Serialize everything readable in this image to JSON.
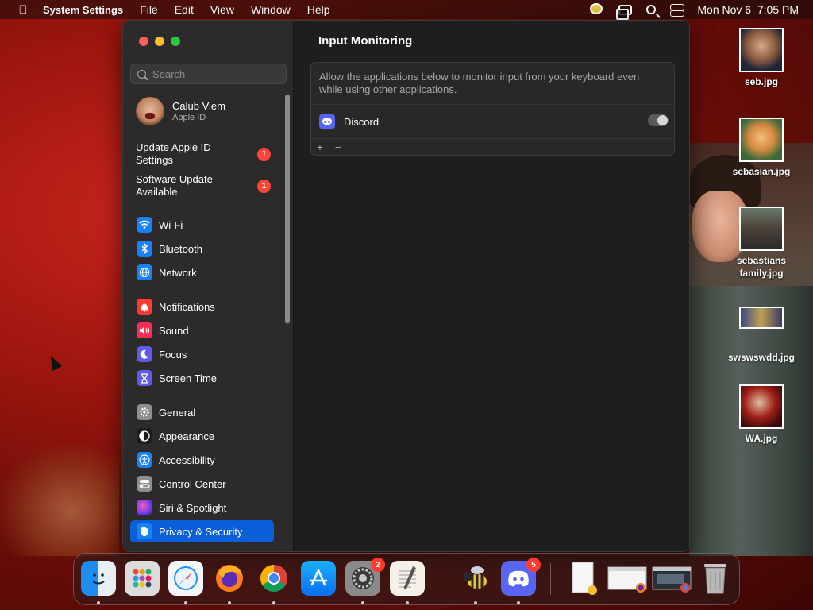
{
  "menubar": {
    "app_name": "System Settings",
    "menus": [
      "File",
      "Edit",
      "View",
      "Window",
      "Help"
    ],
    "clock": "Mon Nov 6  7:05 PM"
  },
  "sidebar": {
    "search_placeholder": "Search",
    "profile": {
      "name": "Calub Viem",
      "subtitle": "Apple ID"
    },
    "alerts": [
      {
        "label": "Update Apple ID Settings",
        "badge": "1"
      },
      {
        "label": "Software Update Available",
        "badge": "1"
      }
    ],
    "items": [
      {
        "label": "Wi-Fi",
        "icon": "wifi-icon",
        "color": "#1a82f7"
      },
      {
        "label": "Bluetooth",
        "icon": "bluetooth-icon",
        "color": "#1a82f7"
      },
      {
        "label": "Network",
        "icon": "globe-icon",
        "color": "#1a82f7"
      },
      {
        "label": "Notifications",
        "icon": "bell-icon",
        "color": "#ff3b30"
      },
      {
        "label": "Sound",
        "icon": "speaker-icon",
        "color": "#ff2d55"
      },
      {
        "label": "Focus",
        "icon": "moon-icon",
        "color": "#5e5ce6"
      },
      {
        "label": "Screen Time",
        "icon": "hourglass-icon",
        "color": "#5e5ce6"
      },
      {
        "label": "General",
        "icon": "gear-icon",
        "color": "#8e8e93"
      },
      {
        "label": "Appearance",
        "icon": "appearance-icon",
        "color": "#1c1c1e"
      },
      {
        "label": "Accessibility",
        "icon": "accessibility-icon",
        "color": "#1a82f7"
      },
      {
        "label": "Control Center",
        "icon": "toggles-icon",
        "color": "#8e8e93"
      },
      {
        "label": "Siri & Spotlight",
        "icon": "siri-icon",
        "color": "#b44cf0"
      },
      {
        "label": "Privacy & Security",
        "icon": "hand-icon",
        "color": "#1a82f7",
        "active": true
      }
    ]
  },
  "content": {
    "title": "Input Monitoring",
    "description": "Allow the applications below to monitor input from your keyboard even while using other applications.",
    "apps": [
      {
        "name": "Discord",
        "enabled": false
      }
    ],
    "add_label": "+",
    "remove_label": "−"
  },
  "desktop": {
    "files": [
      {
        "label": "seb.jpg"
      },
      {
        "label": "sebasian.jpg"
      },
      {
        "label": "sebastians family.jpg"
      },
      {
        "label": "swswswdd.jpg"
      },
      {
        "label": "WA.jpg"
      }
    ]
  },
  "dock": {
    "system_settings_badge": "2",
    "discord_badge": "5"
  }
}
